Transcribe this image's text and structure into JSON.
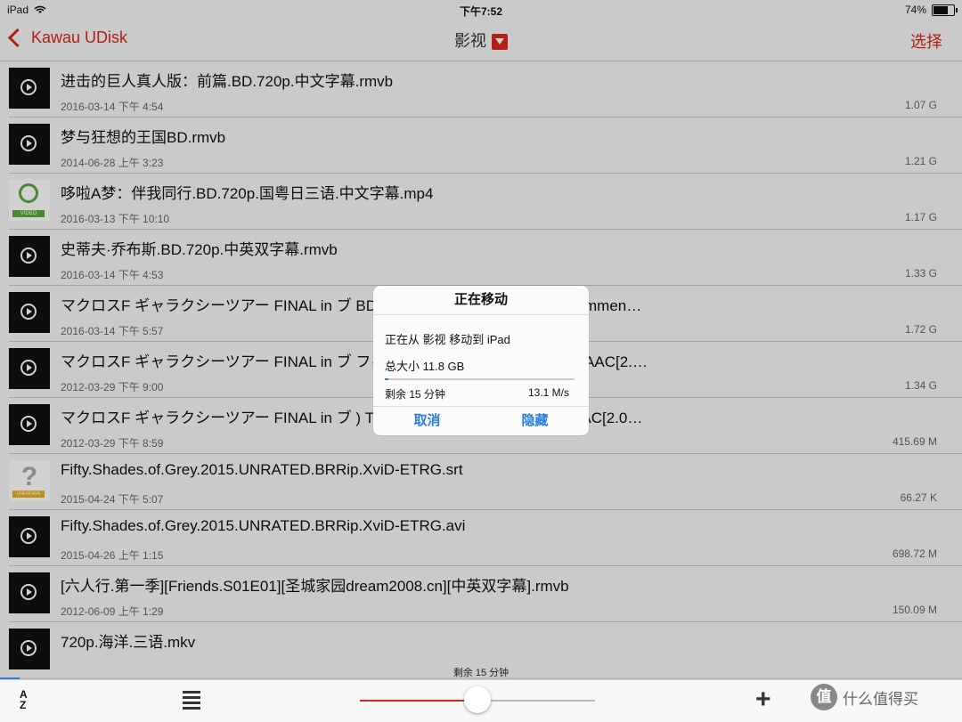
{
  "status": {
    "device": "iPad",
    "time": "下午7:52",
    "battery": "74%"
  },
  "nav": {
    "back_label": "Kawau UDisk",
    "title": "影视",
    "select_label": "选择"
  },
  "files": [
    {
      "name": "进击的巨人真人版：前篇.BD.720p.中文字幕.rmvb",
      "date": "2016-03-14 下午 4:54",
      "size": "1.07 G",
      "thumb": "video"
    },
    {
      "name": "梦与狂想的王国BD.rmvb",
      "date": "2014-06-28 上午 3:23",
      "size": "1.21 G",
      "thumb": "video"
    },
    {
      "name": "哆啦A梦：伴我同行.BD.720p.国粤日三语.中文字幕.mp4",
      "date": "2016-03-13 下午 10:10",
      "size": "1.17 G",
      "thumb": "video-badge"
    },
    {
      "name": "史蒂夫·乔布斯.BD.720p.中英双字幕.rmvb",
      "date": "2016-03-14 下午 4:53",
      "size": "1.33 G",
      "thumb": "video"
    },
    {
      "name": "マクロスF ギャラクシーツアー FINAL in ブ                              BD 1920x1080i x264 AAC[2.0+Commen…",
      "date": "2016-03-14 下午 5:57",
      "size": "1.72 G",
      "thumb": "video"
    },
    {
      "name": "マクロスF ギャラクシーツアー FINAL in ブ                              フィコ横浜 (BD 1920x1080i x264 AAC[2.…",
      "date": "2012-03-29 下午 9:00",
      "size": "1.34 G",
      "thumb": "video"
    },
    {
      "name": "マクロスF ギャラクシーツアー FINAL in ブ                            ) TOKYO (BD 1920x1080i x264 AAC[2.0…",
      "date": "2012-03-29 下午 8:59",
      "size": "415.69 M",
      "thumb": "video"
    },
    {
      "name": "Fifty.Shades.of.Grey.2015.UNRATED.BRRip.XviD-ETRG.srt",
      "date": "2015-04-24 下午 5:07",
      "size": "66.27 K",
      "thumb": "unknown"
    },
    {
      "name": "Fifty.Shades.of.Grey.2015.UNRATED.BRRip.XviD-ETRG.avi",
      "date": "2015-04-26 上午 1:15",
      "size": "698.72 M",
      "thumb": "video"
    },
    {
      "name": "[六人行.第一季][Friends.S01E01][圣城家园dream2008.cn][中英双字幕].rmvb",
      "date": "2012-06-09 上午 1:29",
      "size": "150.09 M",
      "thumb": "video"
    },
    {
      "name": "720p.海洋.三语.mkv",
      "date": "",
      "size": "",
      "thumb": "video"
    }
  ],
  "thumb_labels": {
    "video_badge": "VIDEO",
    "unknown_badge": "UNKNOWN",
    "unknown_glyph": "?"
  },
  "modal": {
    "title": "正在移动",
    "move_text": "正在从 影视 移动到 iPad",
    "total_text": "总大小 11.8 GB",
    "progress": 0.02,
    "remaining": "剩余 15 分钟",
    "speed": "13.1 M/s",
    "cancel_label": "取消",
    "hide_label": "隐藏"
  },
  "bottom": {
    "remaining": "剩余 15 分钟",
    "transfer_progress": 0.02,
    "sort_label_top": "A",
    "sort_label_bottom": "Z",
    "slider_value": 0.5,
    "plus_glyph": "+"
  },
  "watermark": {
    "glyph": "值",
    "text": "什么值得买"
  },
  "colors": {
    "accent_red": "#d9261c",
    "accent_blue": "#2a7be4"
  }
}
